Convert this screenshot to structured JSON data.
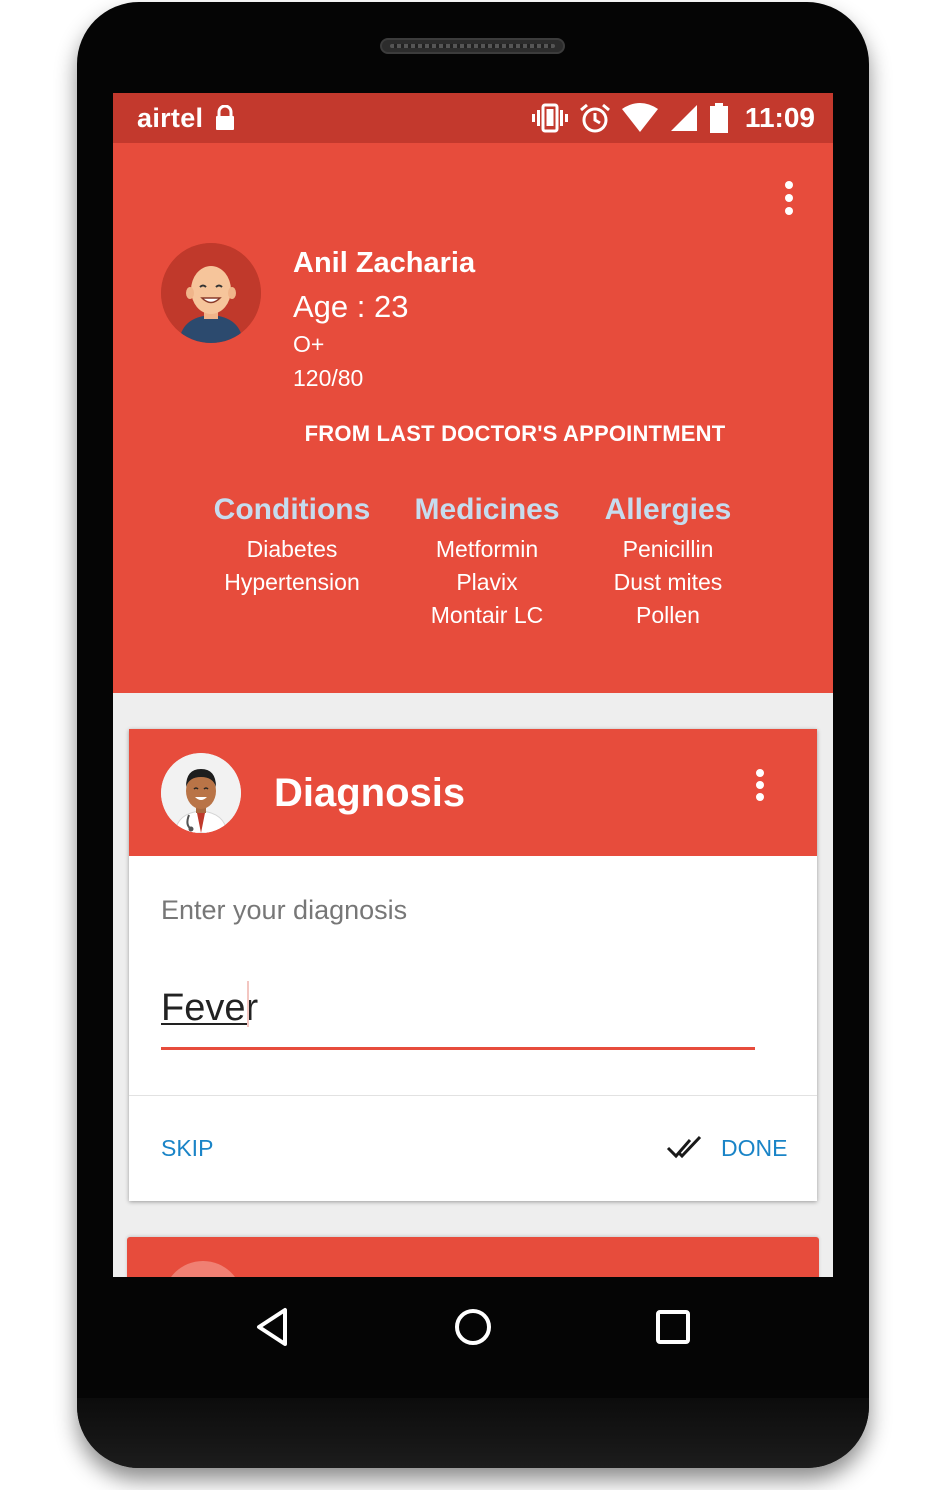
{
  "status_bar": {
    "carrier": "airtel",
    "time": "11:09",
    "icons": [
      "lock-icon",
      "vibrate-icon",
      "alarm-icon",
      "wifi-icon",
      "signal-icon",
      "battery-icon"
    ]
  },
  "profile": {
    "name": "Anil Zacharia",
    "age": "Age : 23",
    "blood_group": "O+",
    "blood_pressure": "120/80",
    "appointment_title": "FROM LAST DOCTOR'S APPOINTMENT",
    "columns": [
      {
        "title": "Conditions",
        "items": [
          "Diabetes",
          "Hypertension"
        ]
      },
      {
        "title": "Medicines",
        "items": [
          "Metformin",
          "Plavix",
          "Montair LC"
        ]
      },
      {
        "title": "Allergies",
        "items": [
          "Penicillin",
          "Dust mites",
          "Pollen"
        ]
      }
    ]
  },
  "diagnosis_card": {
    "title": "Diagnosis",
    "label": "Enter your diagnosis",
    "value": "Fever",
    "skip_label": "SKIP",
    "done_label": "DONE"
  },
  "nav_bar": {
    "icons": [
      "back-icon",
      "home-icon",
      "recents-icon"
    ]
  },
  "colors": {
    "primary": "#e74c3c",
    "status_bar": "#c3392d",
    "accent_text": "#1a84c7",
    "column_title": "#c6dcee"
  }
}
